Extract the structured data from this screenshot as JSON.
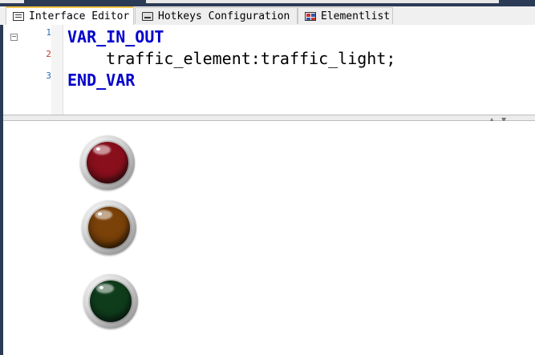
{
  "tabs": [
    {
      "label": "Interface Editor",
      "icon": "editor-icon",
      "active": true
    },
    {
      "label": "Hotkeys Configuration",
      "icon": "keyboard-icon",
      "active": false
    },
    {
      "label": "Elementlist",
      "icon": "element-list-icon",
      "active": false
    }
  ],
  "editor": {
    "lines": [
      {
        "number": "1",
        "text": "VAR_IN_OUT",
        "keyword": true
      },
      {
        "number": "2",
        "text": "    traffic_element:traffic_light;",
        "keyword": false
      },
      {
        "number": "3",
        "text": "END_VAR",
        "keyword": true
      }
    ],
    "fold_symbol": "−"
  },
  "splitter": {
    "up_arrow": "▲",
    "down_arrow": "▼"
  },
  "traffic_lights": [
    {
      "name": "red",
      "color": "#8a0f1c"
    },
    {
      "name": "yellow",
      "color": "#7a4108"
    },
    {
      "name": "green",
      "color": "#0f3d1c"
    }
  ],
  "colors": {
    "keyword": "#0000cc",
    "accent_tab": "#f7c64a",
    "frame": "#2b3a55"
  }
}
